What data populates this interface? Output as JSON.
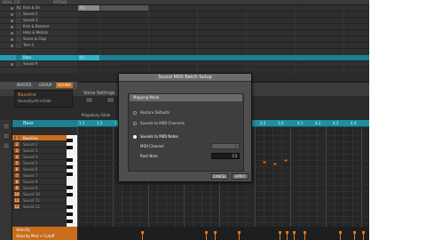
{
  "top_strip": {
    "left_label": "SOUL_CLY",
    "right_label": "PATRNS"
  },
  "group_list": {
    "items": [
      {
        "num": "",
        "label": "Kick & Sn"
      },
      {
        "num": "",
        "label": "Sound 2"
      },
      {
        "num": "",
        "label": "Sound 3"
      },
      {
        "num": "",
        "label": "Kick & Boomer"
      },
      {
        "num": "",
        "label": "Hats & Metals"
      },
      {
        "num": "",
        "label": "Snare & Clap"
      },
      {
        "num": "",
        "label": "Tom 2"
      },
      {
        "num": "",
        "label": "Bass"
      },
      {
        "num": "",
        "label": "Sound 9"
      }
    ]
  },
  "arranger": {
    "clip_label_top": "A1",
    "clip_label_row": "A1"
  },
  "control_band": {
    "tabs": [
      "MASTER",
      "GROUP",
      "SOUND"
    ],
    "sound_name": "Bassline",
    "sound_sub": "HouseSynth+Glide",
    "voice_settings": "Voice Settings",
    "polyphony": "Polyphony  Glide"
  },
  "pattern": {
    "label": "Bass"
  },
  "ruler": {
    "marks": [
      "1.1",
      "1.2",
      "1.3",
      "1.4",
      "2.1",
      "2.2",
      "2.3",
      "2.4",
      "3.1",
      "3.2",
      "3.3",
      "3.4",
      "4.1",
      "4.2",
      "4.3",
      "4.4"
    ]
  },
  "pad_list": {
    "items": [
      "Bassline",
      "Sound 2",
      "Sound 3",
      "Sound 4",
      "Sound 5",
      "Sound 6",
      "Sound 7",
      "Sound 8",
      "Sound 9",
      "Sound 10",
      "Sound 11",
      "Sound 12"
    ]
  },
  "velocity": {
    "labels": [
      "Velocity",
      "Velocity Mod + Cutoff"
    ]
  },
  "dialog": {
    "title": "Sound MIDI Batch Setup",
    "section_title": "Mapping Mode",
    "options": [
      {
        "label": "Restore Defaults",
        "selected": false
      },
      {
        "label": "Sounds to MIDI Channels",
        "selected": false
      },
      {
        "label": "Sounds to MIDI Notes",
        "selected": true
      }
    ],
    "fields": [
      {
        "label": "MIDI Channel",
        "value": "1"
      },
      {
        "label": "Root Note",
        "value": "C3"
      }
    ],
    "cancel_label": "CANCEL",
    "apply_label": "APPLY"
  },
  "colors": {
    "accent_orange": "#c96d1c",
    "accent_teal": "#1e9fb5",
    "note_orange": "#e07a20"
  }
}
